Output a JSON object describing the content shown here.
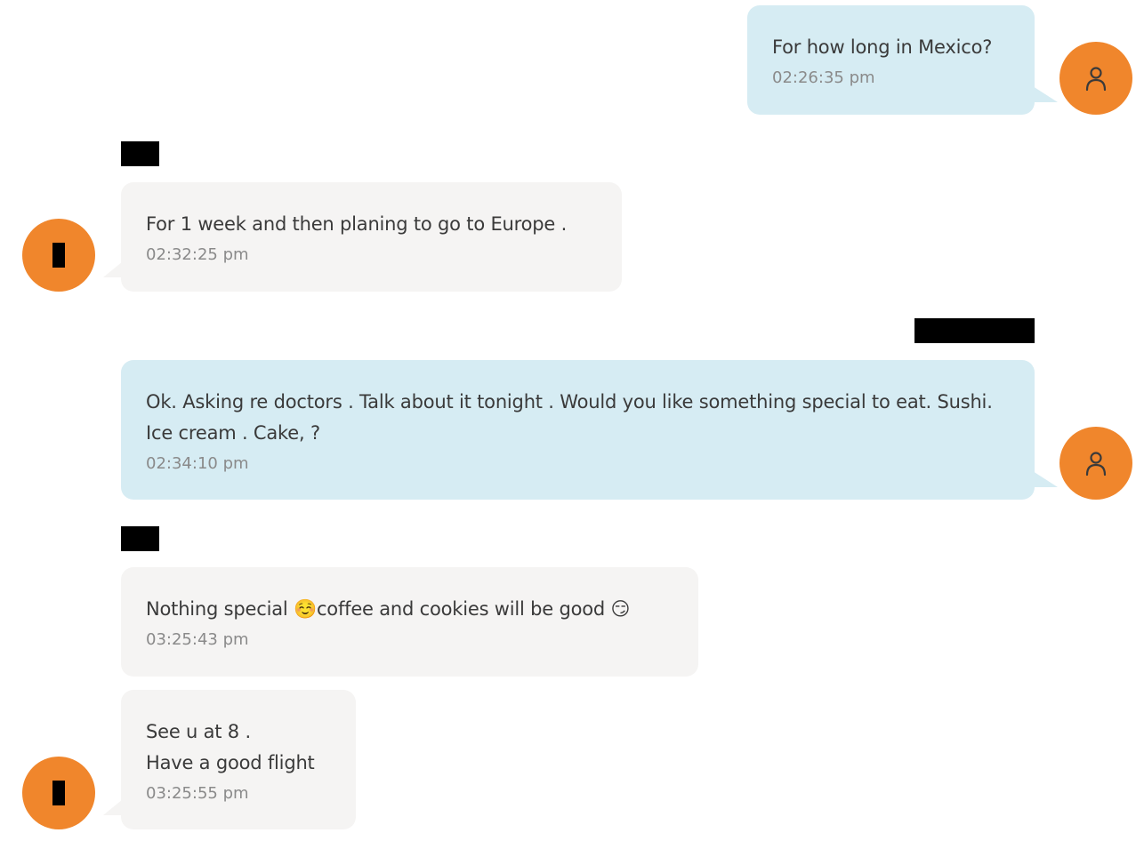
{
  "colors": {
    "outgoing_bubble": "#d6ecf3",
    "incoming_bubble": "#f5f4f3",
    "avatar_orange": "#f0862c",
    "text": "#3a3a3a",
    "timestamp": "#8a8a8a",
    "redaction": "#000000"
  },
  "icons": {
    "outgoing_avatar": "user-icon",
    "incoming_avatar": "redacted-initial-icon"
  },
  "messages": [
    {
      "direction": "outgoing",
      "text": "For how long in Mexico?",
      "time": "02:26:35 pm"
    },
    {
      "direction": "incoming",
      "sender_redacted": true,
      "text": "For 1 week and then planing to go to Europe .",
      "time": "02:32:25 pm"
    },
    {
      "direction": "outgoing",
      "sender_redacted": true,
      "text": "Ok. Asking re doctors .  Talk about it tonight .  Would you like something special to eat.  Sushi. Ice cream . Cake, ?",
      "time": "02:34:10 pm"
    },
    {
      "direction": "incoming",
      "sender_redacted": true,
      "text": "Nothing special ☺️coffee and cookies will be good 😏",
      "time": "03:25:43 pm"
    },
    {
      "direction": "incoming",
      "text": "See u at 8 .\nHave a good flight",
      "time": "03:25:55 pm"
    }
  ]
}
